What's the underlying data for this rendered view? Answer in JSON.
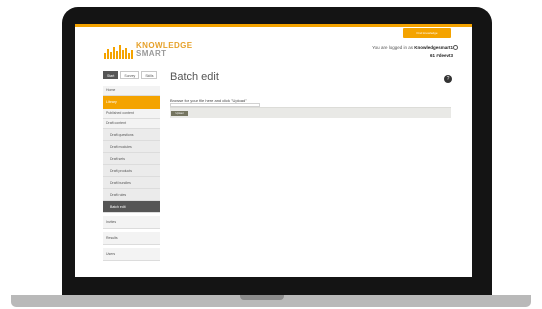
{
  "header": {
    "action_button": "Find knowledge",
    "logo": {
      "line1": "KNOWLEDGE",
      "line2": "SMART"
    },
    "login_prefix": "You are logged in as",
    "username": "Knowledgesmart1",
    "account_id": "61 #deevt3"
  },
  "sidebar": {
    "tabs": [
      "Start",
      "Survey",
      "Skills"
    ],
    "nav": {
      "home": "Home",
      "library": "Library",
      "published_content": "Published content",
      "draft_content": "Draft content",
      "sub_items": [
        "Draft questions",
        "Draft modules",
        "Draft sets",
        "Draft products",
        "Draft bundles",
        "Draft rules",
        "Batch edit"
      ],
      "invites": "Invites",
      "results": "Results",
      "users": "Users"
    }
  },
  "main": {
    "title": "Batch edit",
    "help_icon_label": "?",
    "instructions": "Browse for your file here and click \"Upload\"",
    "upload_button": "Upload"
  },
  "colors": {
    "accent": "#f4a300",
    "sidebar_active": "#555555",
    "upload_button": "#757560"
  }
}
